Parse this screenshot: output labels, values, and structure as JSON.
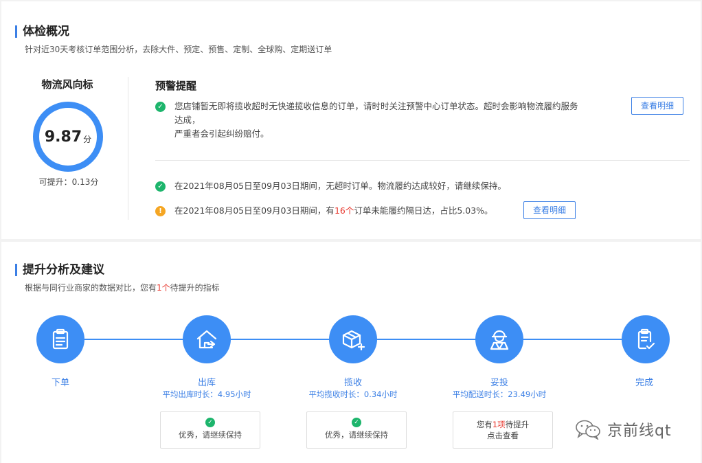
{
  "overview": {
    "title": "体检概况",
    "subtitle": "针对近30天考核订单范围分析，去除大件、预定、预售、定制、全球购、定期送订单",
    "score_title": "物流风向标",
    "score_value": "9.87",
    "score_unit": "分",
    "improve_text": "可提升：0.13分"
  },
  "warnings": {
    "title": "预警提醒",
    "alert1_line1": "您店铺暂无即将揽收超时无快递揽收信息的订单，请时时关注预警中心订单状态。超时会影响物流履约服务",
    "alert1_line2": "达成，",
    "alert1_line3": "严重者会引起纠纷赔付。",
    "alert1_button": "查看明细",
    "alert2": "在2021年08月05日至09月03日期间，无超时订单。物流履约达成较好，请继续保持。",
    "alert3_pre": "在2021年08月05日至09月03日期间，有",
    "alert3_count": "16个",
    "alert3_post": "订单未能履约隔日达，占比5.03%。",
    "alert3_button": "查看明细"
  },
  "analysis": {
    "title": "提升分析及建议",
    "subtitle_pre": "根据与同行业商家的数据对比，您有",
    "subtitle_count": "1个",
    "subtitle_post": "待提升的指标"
  },
  "flow": {
    "steps": [
      {
        "label": "下单",
        "sub": "",
        "icon": "order-clipboard-icon"
      },
      {
        "label": "出库",
        "sub": "平均出库时长：4.95小时",
        "icon": "warehouse-out-icon"
      },
      {
        "label": "揽收",
        "sub": "平均揽收时长：0.34小时",
        "icon": "package-pickup-icon"
      },
      {
        "label": "妥投",
        "sub": "平均配送时长：23.49小时",
        "icon": "courier-icon"
      },
      {
        "label": "完成",
        "sub": "",
        "icon": "done-clipboard-icon"
      }
    ],
    "card_outbound": "优秀，请继续保持",
    "card_pickup": "优秀，请继续保持",
    "card_delivery_pre": "您有",
    "card_delivery_count": "1项",
    "card_delivery_post": "待提升",
    "card_delivery_link": "点击查看"
  },
  "watermark": {
    "text": "京前线qt",
    "icon": "wechat-icon"
  },
  "colors": {
    "accent": "#3d8ef5",
    "ok": "#1db56c",
    "warn": "#f5a623",
    "highlight": "#e8392f"
  }
}
